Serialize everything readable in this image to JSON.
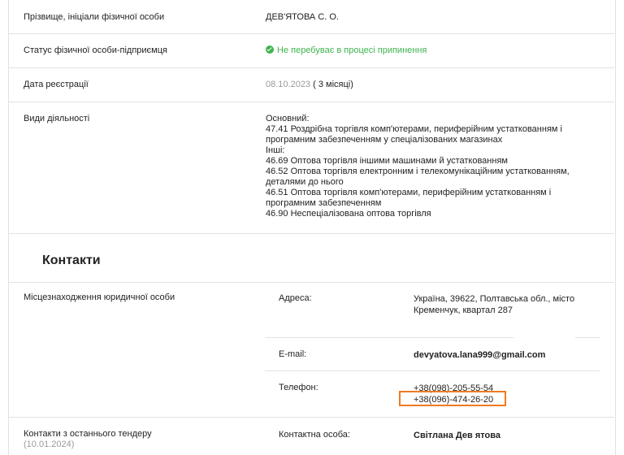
{
  "rows": {
    "name": {
      "label": "Прізвище, ініціали фізичної особи",
      "value": "ДЕВ'ЯТОВА С. О."
    },
    "status": {
      "label": "Статус фізичної особи-підприємця",
      "value": "Не перебуває в процесі припинення"
    },
    "reg": {
      "label": "Дата реєстрації",
      "date": "08.10.2023",
      "duration": "( 3 місяці)"
    },
    "activities": {
      "label": "Види діяльності",
      "lines": [
        "Основний:",
        "47.41 Роздрібна торгівля комп'ютерами, периферійним устаткованням і",
        "програмним забезпеченням у спеціалізованих магазинах",
        "Інші:",
        "46.69 Оптова торгівля іншими машинами й устаткованням",
        "46.52 Оптова торгівля електронним і телекомунікаційним устаткованням,",
        "деталями до нього",
        "46.51 Оптова торгівля комп'ютерами, периферійним устаткованням і",
        "програмним забезпеченням",
        "46.90 Неспеціалізована оптова торгівля"
      ]
    }
  },
  "contacts": {
    "heading": "Контакти",
    "location_label": "Місцезнаходження юридичної особи",
    "address_label": "Адреса:",
    "address_line1": "Україна, 39622, Полтавська обл., місто",
    "address_line2": "Кременчук, квартал 287",
    "email_label": "E-mail:",
    "email": "devyatova.lana999@gmail.com",
    "phone_label": "Телефон:",
    "phone1": "+38(098)-205-55-54",
    "phone2": "+38(096)-474-26-20",
    "tender_label": "Контакти з останнього тендеру",
    "tender_date": "(10.01.2024)",
    "contact_person_label": "Контактна особа:",
    "contact_person": "Світлана Дев ятова"
  },
  "colors": {
    "accent_green": "#3fb34f",
    "link_blue": "#5bbad6",
    "highlight_orange": "#f07a22"
  }
}
